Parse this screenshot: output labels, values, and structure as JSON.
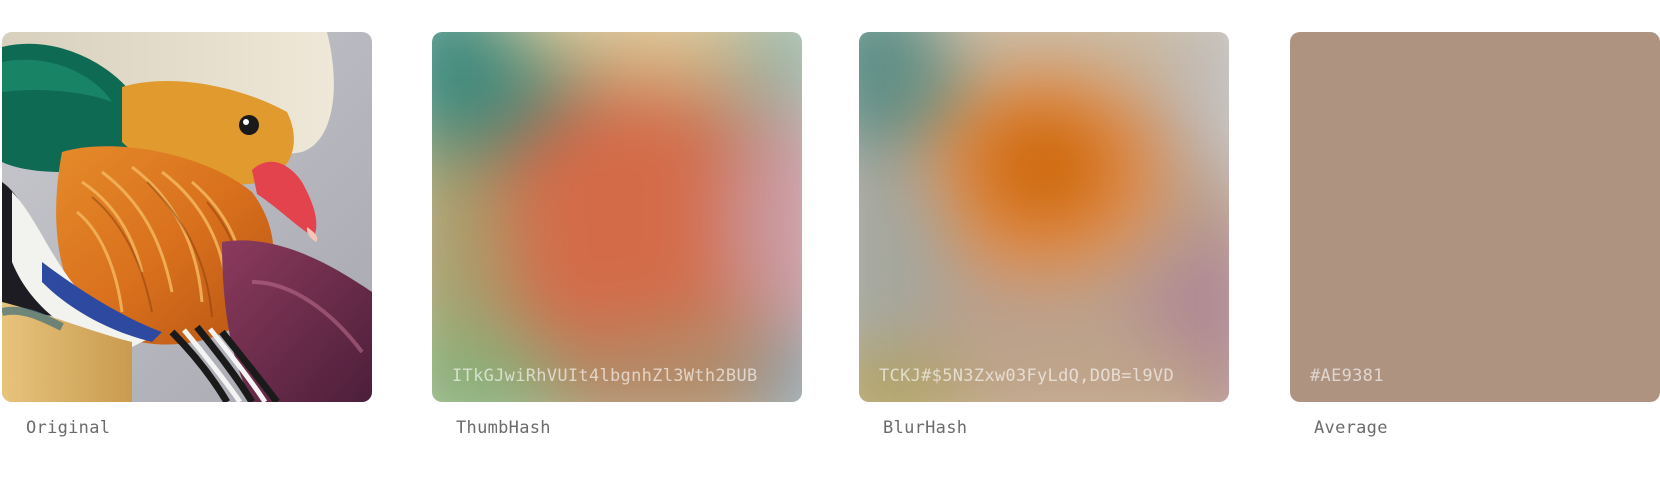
{
  "tiles": [
    {
      "caption": "Original",
      "hash": ""
    },
    {
      "caption": "ThumbHash",
      "hash": "ITkGJwiRhVUIt4lbgnhZl3Wth2BUB"
    },
    {
      "caption": "BlurHash",
      "hash": "TCKJ#$5N3Zxw03FyLdQ,DOB=l9VD"
    },
    {
      "caption": "Average",
      "hash": "#AE9381"
    }
  ],
  "colors": {
    "average": "#AE9381",
    "caption_text": "#6B6B6B"
  }
}
